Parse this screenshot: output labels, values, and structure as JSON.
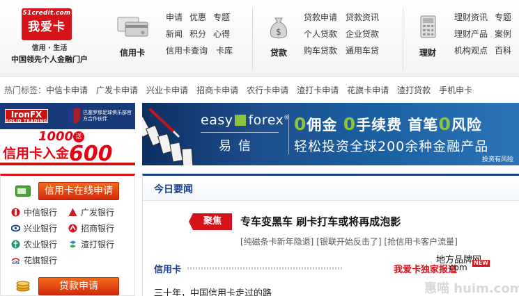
{
  "logo": {
    "url": "51credit.com",
    "name": "我爱卡",
    "tagline": "信用 · 生活",
    "slogan": "中国领先个人金融门户"
  },
  "nav": {
    "card": {
      "title": "信用卡",
      "links": [
        "申请",
        "优惠",
        "专题",
        "新闻",
        "积分",
        "心得",
        "信用卡查询",
        "卡库"
      ]
    },
    "loan": {
      "title": "贷款",
      "links": [
        "贷款申请",
        "贷款资讯",
        "个人贷款",
        "企业贷款",
        "购车贷款",
        "通用车贷"
      ]
    },
    "finance": {
      "title": "理财",
      "links": [
        "理财资讯",
        "专题",
        "理财产品",
        "案例",
        "机构观点",
        "百科"
      ]
    }
  },
  "hot_tags": {
    "label": "热门标签：",
    "tags": [
      "中信卡申请",
      "广发卡申请",
      "兴业卡申请",
      "招商卡申请",
      "农行卡申请",
      "渣打卡申请",
      "花旗卡申请",
      "渣打贷款",
      "手机申卡"
    ]
  },
  "ad_left": {
    "brand": "IronFX",
    "brand_sub": "SOLID TRADING",
    "partner": "巴塞罗那足球俱乐部官方合作伙伴",
    "amount1": "1000",
    "badge": "送",
    "line2_prefix": "信用卡入金",
    "amount2": "600"
  },
  "banner": {
    "logo_text": "easy",
    "logo_text2": "forex",
    "reg_mark": "®",
    "logo_cn": "易信",
    "headline_parts": [
      "0",
      "佣金 ",
      "0",
      "手续费 首笔",
      "0",
      "风险"
    ],
    "subline": "轻松投资全球200余种金融产品",
    "risk": "投资有风险"
  },
  "left_col": {
    "apply_card": "信用卡在线申请",
    "banks": [
      "中信银行",
      "广发银行",
      "兴业银行",
      "招商银行",
      "农业银行",
      "渣打银行",
      "花旗银行"
    ],
    "apply_loan": "贷款申请"
  },
  "main": {
    "today_title": "今日要闻",
    "focus_tag": "聚焦",
    "headline": "专车变黑车  刷卡打车或将再成泡影",
    "sublinks": [
      "[纯磁条卡新年隐退]",
      "[银联开始反击了]",
      "[抢信用卡客户流量]"
    ],
    "section_title": "信用卡",
    "article": "三十年，中国信用卡走过的路",
    "exclusive": "我爱卡独家报道",
    "new_badge": "NEW",
    "wm1": "地方品牌网",
    "wm2": "com",
    "wm3": "惠喵 huim.com"
  },
  "colors": {
    "brand_red": "#d6121b",
    "nav_blue": "#1a3f8c",
    "btn_orange": "#f26a1b",
    "forex_green": "#8cc43c"
  }
}
